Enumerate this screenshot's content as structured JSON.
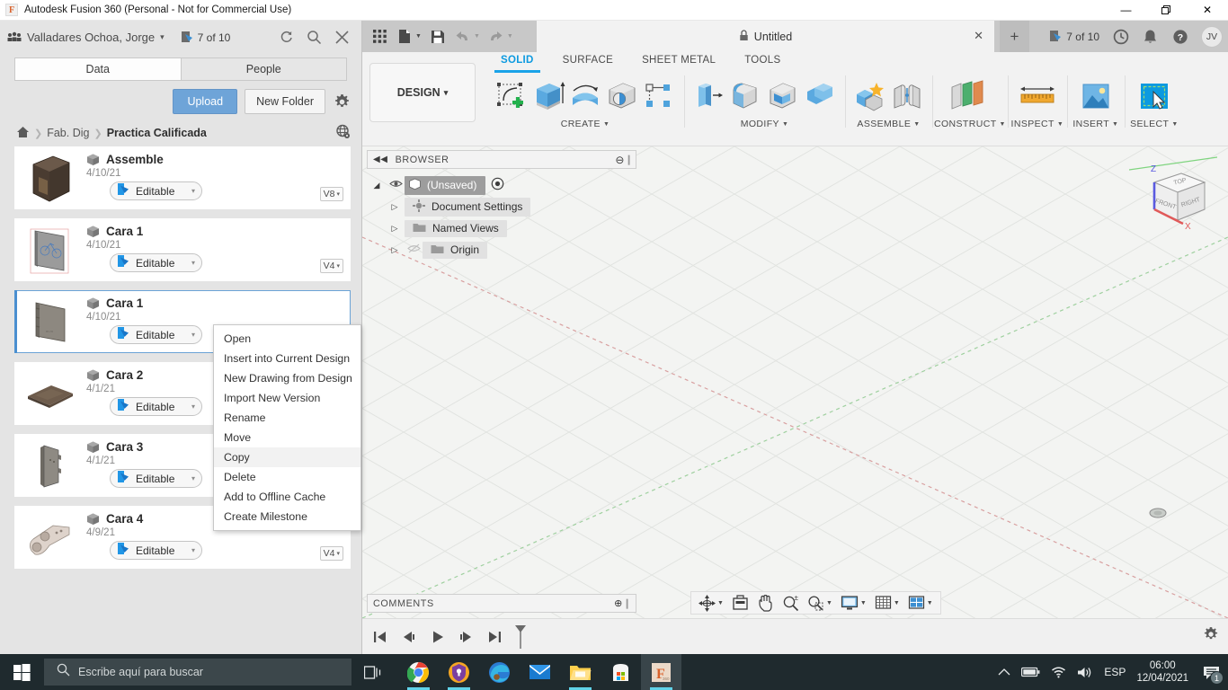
{
  "window": {
    "title": "Autodesk Fusion 360 (Personal - Not for Commercial Use)",
    "app_icon": "F",
    "minimize": "—",
    "maximize": "❐",
    "close": "✕"
  },
  "data_panel": {
    "account_name": "Valladares Ochoa, Jorge",
    "account_caret": "▾",
    "jobs_badge": "7 of 10",
    "refresh_icon": "refresh-icon",
    "search_icon": "search-icon",
    "close_icon": "close-icon",
    "tabs": [
      {
        "label": "Data",
        "active": true
      },
      {
        "label": "People",
        "active": false
      }
    ],
    "upload_label": "Upload",
    "new_folder_label": "New Folder",
    "settings_icon": "gear-icon",
    "breadcrumb": {
      "home_icon": "home-icon",
      "separator": "❯",
      "items": [
        "Fab. Dig",
        "Practica Calificada"
      ],
      "globe_icon": "globe-icon"
    },
    "files": [
      {
        "name": "Assemble",
        "date": "4/10/21",
        "status": "Editable",
        "version": "V8",
        "selected": false,
        "thumb": "assembly-box"
      },
      {
        "name": "Cara 1",
        "date": "4/10/21",
        "status": "Editable",
        "version": "V4",
        "selected": false,
        "thumb": "panel-engraved"
      },
      {
        "name": "Cara 1",
        "date": "4/10/21",
        "status": "Editable",
        "version": "",
        "selected": true,
        "thumb": "panel-plain"
      },
      {
        "name": "Cara 2",
        "date": "4/1/21",
        "status": "Editable",
        "version": "",
        "selected": false,
        "thumb": "flat-plate"
      },
      {
        "name": "Cara 3",
        "date": "4/1/21",
        "status": "Editable",
        "version": "",
        "selected": false,
        "thumb": "side-panel"
      },
      {
        "name": "Cara 4",
        "date": "4/9/21",
        "status": "Editable",
        "version": "V4",
        "selected": false,
        "thumb": "bracket"
      }
    ],
    "status_caret": "▾",
    "version_caret": "▾"
  },
  "context_menu": {
    "items": [
      {
        "label": "Open",
        "hover": false
      },
      {
        "label": "Insert into Current Design",
        "hover": false
      },
      {
        "label": "New Drawing from Design",
        "hover": false
      },
      {
        "label": "Import New Version",
        "hover": false
      },
      {
        "label": "Rename",
        "hover": false
      },
      {
        "label": "Move",
        "hover": false
      },
      {
        "label": "Copy",
        "hover": true
      },
      {
        "label": "Delete",
        "hover": false
      },
      {
        "label": "Add to Offline Cache",
        "hover": false
      },
      {
        "label": "Create Milestone",
        "hover": false
      }
    ]
  },
  "fusion": {
    "quick_access": [
      {
        "name": "app-grid-icon",
        "disabled": false,
        "caret": false
      },
      {
        "name": "new-file-icon",
        "disabled": false,
        "caret": true
      },
      {
        "name": "save-icon",
        "disabled": false,
        "caret": false
      },
      {
        "name": "undo-icon",
        "disabled": true,
        "caret": true
      },
      {
        "name": "redo-icon",
        "disabled": true,
        "caret": true
      }
    ],
    "document_tab": {
      "lock_icon": "lock-icon",
      "title": "Untitled",
      "close": "✕"
    },
    "new_tab_label": "+",
    "top_right": {
      "jobs_badge": "7 of 10",
      "history_icon": "clock-icon",
      "notification_icon": "bell-icon",
      "help_icon": "help-icon",
      "avatar_initials": "JV"
    },
    "workspace": {
      "label": "DESIGN",
      "caret": "▾"
    },
    "ribbon_tabs": [
      {
        "label": "SOLID",
        "active": true
      },
      {
        "label": "SURFACE",
        "active": false
      },
      {
        "label": "SHEET METAL",
        "active": false
      },
      {
        "label": "TOOLS",
        "active": false
      }
    ],
    "ribbon_panels": [
      {
        "label": "CREATE",
        "has_caret": true,
        "tools": [
          "create-sketch-icon",
          "extrude-icon",
          "revolve-icon",
          "hole-icon",
          "pattern-icon"
        ]
      },
      {
        "label": "MODIFY",
        "has_caret": true,
        "tools": [
          "press-pull-icon",
          "fillet-icon",
          "shell-icon",
          "combine-icon"
        ]
      },
      {
        "label": "ASSEMBLE",
        "has_caret": true,
        "tools": [
          "new-component-icon",
          "joint-icon"
        ]
      },
      {
        "label": "CONSTRUCT",
        "has_caret": true,
        "tools": [
          "offset-plane-icon"
        ]
      },
      {
        "label": "INSPECT",
        "has_caret": true,
        "tools": [
          "measure-icon"
        ]
      },
      {
        "label": "INSERT",
        "has_caret": true,
        "tools": [
          "insert-image-icon"
        ]
      },
      {
        "label": "SELECT",
        "has_caret": true,
        "tools": [
          "select-window-icon"
        ]
      }
    ],
    "browser": {
      "title": "BROWSER",
      "collapse_icon": "collapse-left-icon",
      "minimize_icon": "minus-icon",
      "nodes": [
        {
          "label": "(Unsaved)",
          "depth": 0,
          "icon": "component-icon",
          "has_eye": true,
          "eye_on": true,
          "has_arrow": true,
          "has_radio": true,
          "style": "root"
        },
        {
          "label": "Document Settings",
          "depth": 1,
          "icon": "gear-icon",
          "has_eye": false,
          "eye_on": false,
          "has_arrow": true,
          "has_radio": false,
          "style": "chip"
        },
        {
          "label": "Named Views",
          "depth": 1,
          "icon": "folder-icon",
          "has_eye": false,
          "eye_on": false,
          "has_arrow": true,
          "has_radio": false,
          "style": "chip"
        },
        {
          "label": "Origin",
          "depth": 1,
          "icon": "folder-icon",
          "has_eye": true,
          "eye_on": false,
          "has_arrow": true,
          "has_radio": false,
          "style": "chip"
        }
      ]
    },
    "viewcube": {
      "faces": [
        "TOP",
        "FRONT",
        "RIGHT"
      ],
      "axis_z": "Z",
      "axis_x": "X"
    },
    "comments": {
      "title": "COMMENTS",
      "add_icon": "plus-circle-icon"
    },
    "nav_bar": [
      {
        "name": "orbit-icon",
        "caret": true
      },
      {
        "name": "look-at-icon",
        "caret": false
      },
      {
        "name": "pan-icon",
        "caret": false
      },
      {
        "name": "zoom-icon",
        "caret": false
      },
      {
        "name": "fit-icon",
        "caret": true
      },
      {
        "name": "display-settings-icon",
        "caret": true
      },
      {
        "name": "grid-snap-icon",
        "caret": true
      },
      {
        "name": "viewport-layout-icon",
        "caret": true
      }
    ],
    "timeline": [
      {
        "name": "go-to-beginning-icon"
      },
      {
        "name": "step-back-icon"
      },
      {
        "name": "play-icon"
      },
      {
        "name": "step-forward-icon"
      },
      {
        "name": "go-to-end-icon"
      },
      {
        "name": "timeline-marker-icon"
      }
    ],
    "timeline_settings_icon": "gear-icon"
  },
  "taskbar": {
    "start_icon": "windows-start-icon",
    "search_placeholder": "Escribe aquí para buscar",
    "search_icon": "search-icon",
    "task_view_icon": "task-view-icon",
    "apps": [
      {
        "name": "chrome-icon",
        "active": false,
        "running": true
      },
      {
        "name": "avast-icon",
        "active": false,
        "running": true
      },
      {
        "name": "edge-icon",
        "active": false,
        "running": false
      },
      {
        "name": "mail-icon",
        "active": false,
        "running": false
      },
      {
        "name": "file-explorer-icon",
        "active": false,
        "running": true
      },
      {
        "name": "microsoft-store-icon",
        "active": false,
        "running": false
      },
      {
        "name": "fusion360-icon",
        "active": true,
        "running": true
      }
    ],
    "tray": {
      "chevron_up_icon": "chevron-up-icon",
      "battery_icon": "battery-icon",
      "wifi_icon": "wifi-icon",
      "volume_icon": "volume-icon",
      "language": "ESP",
      "time": "06:00",
      "date": "12/04/2021",
      "notification_count": "1"
    }
  }
}
